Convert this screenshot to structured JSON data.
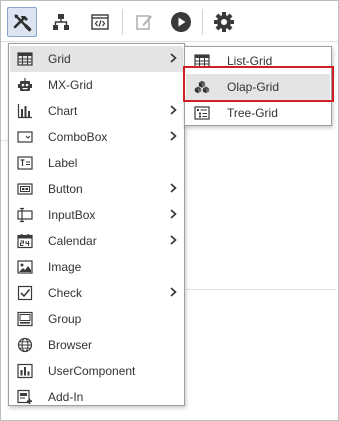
{
  "toolbar": {
    "buttons": [
      {
        "icon": "tools-icon",
        "state": "pressed"
      },
      {
        "icon": "hierarchy-icon"
      },
      {
        "icon": "code-window-icon"
      },
      {
        "icon": "edit-icon",
        "state": "disabled"
      },
      {
        "icon": "play-icon"
      },
      {
        "icon": "gear-icon"
      }
    ]
  },
  "menu": {
    "items": [
      {
        "label": "Grid",
        "icon": "grid-icon",
        "has_submenu": true,
        "state": "hover"
      },
      {
        "label": "MX-Grid",
        "icon": "robot-icon",
        "has_submenu": false
      },
      {
        "label": "Chart",
        "icon": "bar-chart-icon",
        "has_submenu": true
      },
      {
        "label": "ComboBox",
        "icon": "combobox-icon",
        "has_submenu": true
      },
      {
        "label": "Label",
        "icon": "label-icon",
        "has_submenu": false
      },
      {
        "label": "Button",
        "icon": "button-icon",
        "has_submenu": true
      },
      {
        "label": "InputBox",
        "icon": "inputbox-icon",
        "has_submenu": true
      },
      {
        "label": "Calendar",
        "icon": "calendar-icon",
        "has_submenu": true
      },
      {
        "label": "Image",
        "icon": "image-icon",
        "has_submenu": false
      },
      {
        "label": "Check",
        "icon": "checkbox-icon",
        "has_submenu": true
      },
      {
        "label": "Group",
        "icon": "group-icon",
        "has_submenu": false
      },
      {
        "label": "Browser",
        "icon": "globe-icon",
        "has_submenu": false
      },
      {
        "label": "UserComponent",
        "icon": "user-component-icon",
        "has_submenu": false
      },
      {
        "label": "Add-In",
        "icon": "add-in-icon",
        "has_submenu": false
      }
    ]
  },
  "submenu": {
    "items": [
      {
        "label": "List-Grid",
        "icon": "list-grid-icon"
      },
      {
        "label": "Olap-Grid",
        "icon": "cubes-icon",
        "state": "hover",
        "highlighted": true
      },
      {
        "label": "Tree-Grid",
        "icon": "tree-grid-icon"
      }
    ]
  },
  "colors": {
    "highlight_border": "#d21f26",
    "hover_background": "#e4e4e4",
    "pressed_button": "#dbe4f0",
    "icon_dark": "#3a3a3a"
  }
}
